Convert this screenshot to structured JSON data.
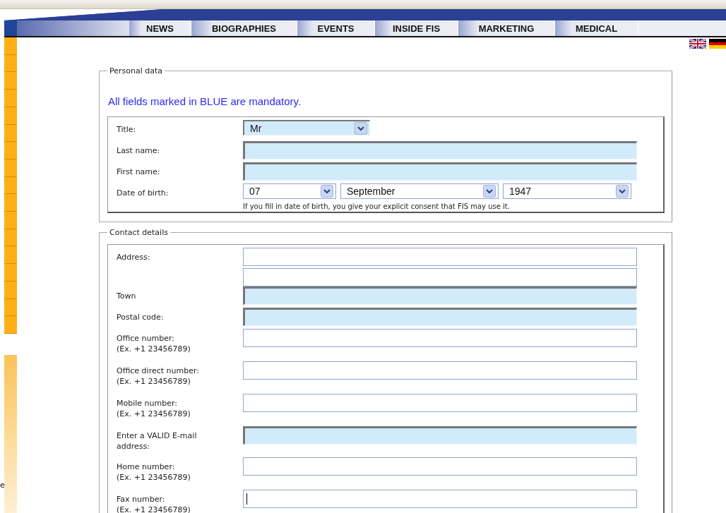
{
  "nav": [
    "NEWS",
    "BIOGRAPHIES",
    "EVENTS",
    "INSIDE FIS",
    "MARKETING",
    "MEDICAL"
  ],
  "sidebar": {
    "fragment": "e"
  },
  "personal_data": {
    "legend": "Personal data",
    "notice": "All fields marked in BLUE are mandatory.",
    "fields": [
      {
        "label": "Title:",
        "inputs": [
          {
            "kind": "select",
            "value": "Mr",
            "mandatory": true
          }
        ]
      },
      {
        "label": "Last name:",
        "inputs": [
          {
            "kind": "text",
            "mandatory": true,
            "focused": false
          }
        ]
      },
      {
        "label": "First name:",
        "inputs": [
          {
            "kind": "text",
            "mandatory": true,
            "focused": false
          }
        ]
      },
      {
        "label": "Date of birth:",
        "inputs": [
          {
            "kind": "select",
            "value": "07",
            "mandatory": false
          },
          {
            "kind": "select",
            "value": "September",
            "mandatory": false
          },
          {
            "kind": "select",
            "value": "1947",
            "mandatory": false
          }
        ],
        "note": "If you fill in date of birth, you give your explicit consent that FIS may use it."
      }
    ]
  },
  "contact_details": {
    "legend": "Contact details",
    "fields": [
      {
        "label": "Address:",
        "inputs": [
          {
            "kind": "text",
            "mandatory": false,
            "focused": false
          },
          {
            "kind": "text",
            "mandatory": false,
            "focused": false
          }
        ]
      },
      {
        "label": "Town",
        "inputs": [
          {
            "kind": "text",
            "mandatory": true,
            "focused": false
          }
        ]
      },
      {
        "label": "Postal code:",
        "inputs": [
          {
            "kind": "text",
            "mandatory": true,
            "focused": false
          }
        ]
      },
      {
        "label": "Office number:",
        "hint": "(Ex. +1 23456789)",
        "inputs": [
          {
            "kind": "text",
            "mandatory": false,
            "focused": false
          }
        ]
      },
      {
        "label": "Office direct number:",
        "hint": "(Ex. +1 23456789)",
        "inputs": [
          {
            "kind": "text",
            "mandatory": false,
            "focused": false
          }
        ]
      },
      {
        "label": "Mobile number:",
        "hint": "(Ex. +1 23456789)",
        "inputs": [
          {
            "kind": "text",
            "mandatory": false,
            "focused": false
          }
        ]
      },
      {
        "label": "Enter a VALID E-mail address:",
        "inputs": [
          {
            "kind": "text",
            "mandatory": true,
            "focused": false
          }
        ]
      },
      {
        "label": "Home number:",
        "hint": "(Ex. +1 23456789)",
        "inputs": [
          {
            "kind": "text",
            "mandatory": false,
            "focused": false
          }
        ]
      },
      {
        "label": "Fax number:",
        "hint": "(Ex. +1 23456789)",
        "inputs": [
          {
            "kind": "text",
            "mandatory": false,
            "focused": true
          }
        ]
      }
    ]
  }
}
